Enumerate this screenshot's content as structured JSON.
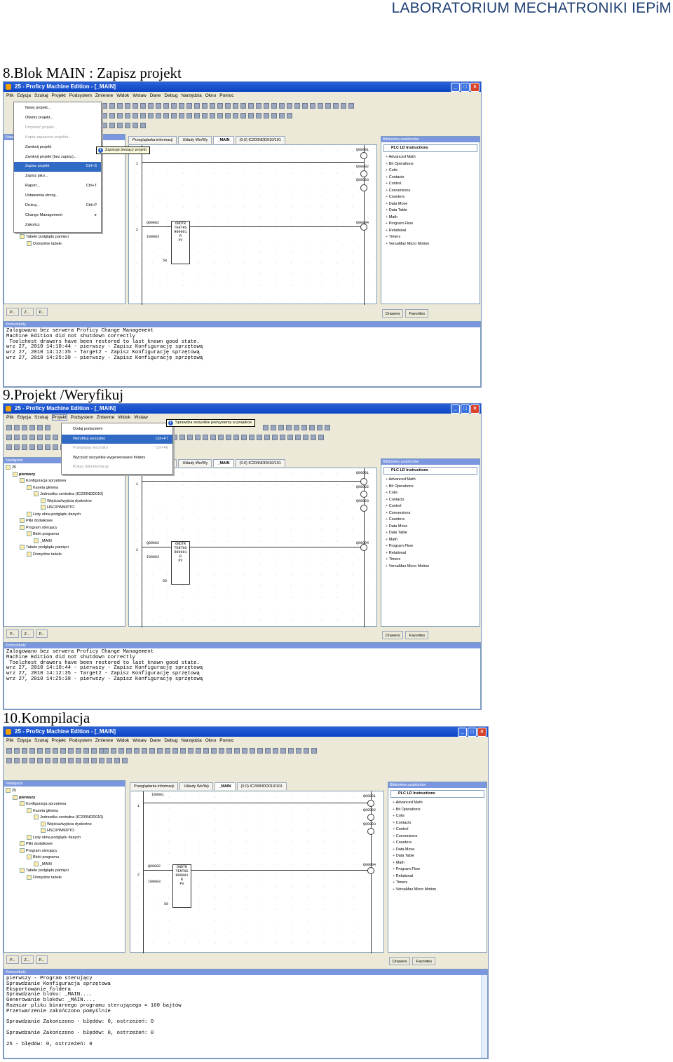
{
  "header": "LABORATORIUM MECHATRONIKI  IEPiM",
  "sections": [
    {
      "title": "8.Blok MAIN : Zapisz projekt",
      "window_title": "25 - Proficy Machine Edition - [_MAIN]",
      "menus": [
        "Plik",
        "Edycja",
        "Szukaj",
        "Projekt",
        "Podsystem",
        "Zmienne",
        "Widok",
        "Wstaw",
        "Dane",
        "Debug",
        "Narzędzia",
        "Okno",
        "Pomoc"
      ],
      "dropdown": [
        {
          "label": "Nowy projekt...",
          "shortcut": "",
          "state": "normal"
        },
        {
          "label": "Otwórz projekt...",
          "shortcut": "",
          "state": "normal"
        },
        {
          "label": "Przywróć projekt...",
          "shortcut": "",
          "state": "disabled"
        },
        {
          "label": "Kopia zapasowa projektu...",
          "shortcut": "",
          "state": "disabled"
        },
        {
          "label": "Zamknij projekt",
          "shortcut": "",
          "state": "normal"
        },
        {
          "label": "Zamknij projekt (bez zapisu)...",
          "shortcut": "",
          "state": "normal"
        },
        {
          "label": "Zapisz projekt",
          "shortcut": "Ctrl+S",
          "state": "highlight"
        },
        {
          "label": "Zapisz jako...",
          "shortcut": "",
          "state": "normal"
        },
        {
          "label": "Raport...",
          "shortcut": "Ctrl+T",
          "state": "normal"
        },
        {
          "label": "Ustawienia strony...",
          "shortcut": "",
          "state": "normal"
        },
        {
          "label": "Drukuj...",
          "shortcut": "Ctrl+P",
          "state": "normal"
        },
        {
          "label": "Change Management",
          "shortcut": "▸",
          "state": "normal"
        },
        {
          "label": "Zakończ",
          "shortcut": "",
          "state": "normal"
        }
      ],
      "tooltip": "Zapisuje bieżący projekt",
      "tree": [
        "Tabele podglądu pamięci",
        "Domyślne tabele"
      ],
      "console": "Zalogowano bez serwera Proficy Change Management\nMachine Edition did not shutdown correctly\n Toolchest drawers have been restored to last known good state.\nwrz 27, 2010 14:10:44 - pierwszy - Zapisz Konfigurację sprzętową\nwrz 27, 2010 14:12:35 - Target2 - Zapisz Konfigurację sprzętową\nwrz 27, 2010 14:25:38 - pierwszy - Zapisz Konfigurację sprzętową"
    },
    {
      "title": "9.Projekt /Weryfikuj",
      "window_title": "25 - Proficy Machine Edition - [_MAIN]",
      "menus": [
        "Plik",
        "Edycja",
        "Szukaj",
        "Projekt",
        "Podsystem",
        "Zmienne",
        "Widok",
        "Wstaw"
      ],
      "dropdown": [
        {
          "label": "Dodaj podsystem",
          "shortcut": "",
          "state": "normal"
        },
        {
          "label": "Weryfikuj wszystko",
          "shortcut": "Ctrl+F7",
          "state": "highlight"
        },
        {
          "label": "Przeglądaj wszystko",
          "shortcut": "Ctrl+F8",
          "state": "disabled"
        },
        {
          "label": "Wyczyść wszystkie wygenerowane foldery",
          "shortcut": "",
          "state": "normal"
        },
        {
          "label": "Pokaż dokumentację",
          "shortcut": "",
          "state": "disabled"
        }
      ],
      "tooltip": "Sprawdza wszystkie podsystemy w projekcie",
      "tree": [
        "25",
        "pierwszy",
        "Konfiguracja sprzętowa",
        "Kaseta główna",
        "Jednostka centralna (IC200NDD010)",
        "Wejścia/wyjścia dyskretne",
        "HSC/PWM/PTO",
        "Listy okna podglądu danych",
        "Pliki dodatkowe",
        "Program sterujący",
        "Bloki programu",
        "_MAIN",
        "Tabele podglądu pamięci",
        "Domyślne tabele"
      ],
      "console": "Zalogowano bez serwera Proficy Change Management\nMachine Edition did not shutdown correctly\n Toolchest drawers have been restored to last known good state.\nwrz 27, 2010 14:10:44 - pierwszy - Zapisz Konfigurację sprzętową\nwrz 27, 2010 14:12:35 - Target2 - Zapisz Konfigurację sprzętową\nwrz 27, 2010 14:25:38 - pierwszy - Zapisz Konfigurację sprzętową"
    },
    {
      "title": "10.Kompilacja",
      "window_title": "25 - Proficy Machine Edition - [_MAIN]",
      "menus": [
        "Plik",
        "Edycja",
        "Szukaj",
        "Projekt",
        "Podsystem",
        "Zmienne",
        "Widok",
        "Wstaw",
        "Dane",
        "Debug",
        "Narzędzia",
        "Okno",
        "Pomoc"
      ],
      "tree": [
        "25",
        "pierwszy",
        "Konfiguracja sprzętowa",
        "Kaseta główna",
        "Jednostka centralna (IC200NDD010)",
        "Wejścia/wyjścia dyskretne",
        "HSC/PWM/PTO",
        "Listy okna podglądu danych",
        "Pliki dodatkowe",
        "Program sterujący",
        "Bloki programu",
        "_MAIN",
        "Tabele podglądu pamięci",
        "Domyślne tabele"
      ],
      "console": "pierwszy - Program sterujący\nSprawdzanie Konfiguracja sprzętowa\nEksportowanie foldera\nSprawdzanie bloku: _MAIN....\nGenerowanie bloków: _MAIN....\nRozmiar pliku binarnego programu sterującego = 160 bajtów\nPrzetwarzenie zakończono pomyślnie\n\nSprawdzanie Zakończono - błędów: 0, ostrzeżeń: 0\n\nSprawdzanie Zakończono - błędów: 0, ostrzeżeń: 0\n\n25 - błędów: 0, ostrzeżeń: 0"
    }
  ],
  "common": {
    "panel_navigator": "Nawigator",
    "panel_messages": "Komunikaty",
    "panel_library": "Biblioteka szablonów",
    "tabs": [
      "Przeglądarka informacji",
      "Układy We/Wy",
      "_MAIN",
      "(0.0) IC200NDD010/101"
    ],
    "plc_combo": "PLC LD Instructions",
    "drawers": [
      "Advanced Math",
      "Bit Operations",
      "Coils",
      "Contacts",
      "Control",
      "Conversions",
      "Counters",
      "Data Move",
      "Data Table",
      "Math",
      "Program Flow",
      "Relational",
      "Timers",
      "VersaMax Micro Motion"
    ],
    "bottom_tabs_left": [
      "P...",
      "Z...",
      "P..."
    ],
    "bottom_tabs_right": [
      "Drawers",
      "Favorites"
    ],
    "ladder": {
      "rung1": "1",
      "rung2": "2",
      "coils": [
        "Q00001",
        "Q00002",
        "Q00003",
        "Q00004"
      ],
      "contacts": [
        "Q00002",
        "I00003"
      ],
      "ondtr": "ONDTR TENTHS",
      "ondtr_r": "R00001",
      "r_label": "R",
      "pv_label": "PV",
      "pv_value": "50",
      "top_contact": "I00001"
    }
  }
}
